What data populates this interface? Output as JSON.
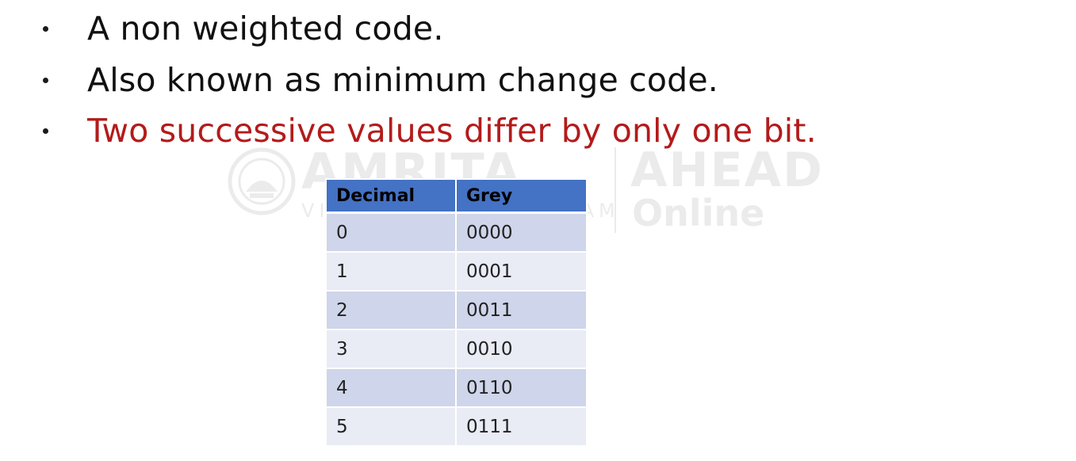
{
  "bullets": [
    {
      "text": "A non weighted code.",
      "color": "#111111"
    },
    {
      "text": "Also known as minimum change code.",
      "color": "#111111"
    },
    {
      "text": "Two successive values differ by only one bit.",
      "color": "#b31b1b"
    }
  ],
  "watermark": {
    "brand": "AMRITA",
    "sub": "VISHWA VIDYAPEETHAM",
    "ahead": "AHEAD",
    "online": "Online"
  },
  "table": {
    "headers": [
      "Decimal",
      "Grey"
    ],
    "header_color": "#4472c4",
    "row_colors": [
      "#cfd5ea",
      "#e9ebf5"
    ],
    "rows": [
      [
        "0",
        "0000"
      ],
      [
        "1",
        "0001"
      ],
      [
        "2",
        "0011"
      ],
      [
        "3",
        "0010"
      ],
      [
        "4",
        "0110"
      ],
      [
        "5",
        "0111"
      ]
    ]
  }
}
